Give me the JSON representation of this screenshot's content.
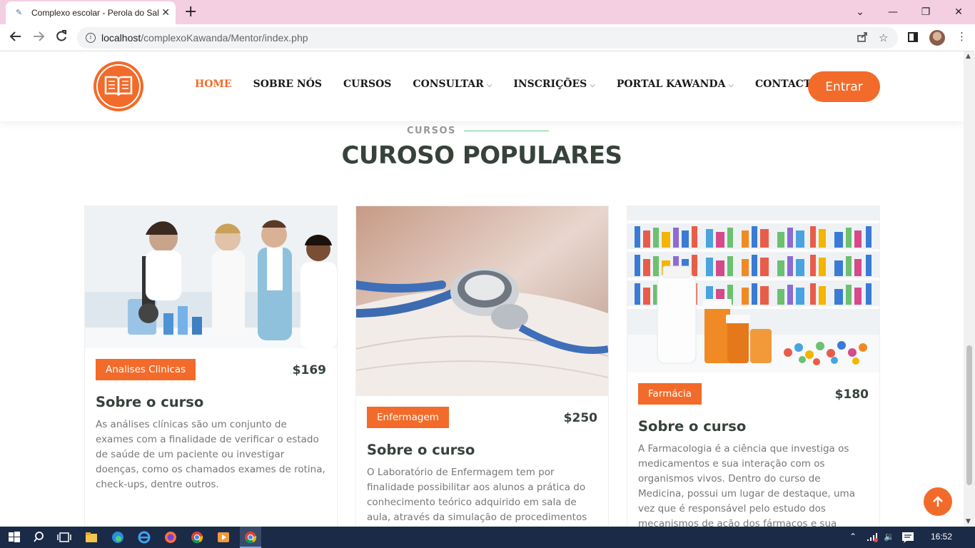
{
  "browser": {
    "tab_title": "Complexo escolar - Perola do Sal",
    "tab_close": "✕",
    "new_tab": "+",
    "url_host": "localhost",
    "url_path": "/complexoKawanda/Mentor/index.php",
    "window_controls": [
      "⌄",
      "—",
      "❐",
      "✕"
    ]
  },
  "nav": {
    "items": [
      {
        "label": "HOME",
        "active": true,
        "dropdown": false
      },
      {
        "label": "SOBRE NÓS",
        "active": false,
        "dropdown": false
      },
      {
        "label": "CURSOS",
        "active": false,
        "dropdown": false
      },
      {
        "label": "CONSULTAR",
        "active": false,
        "dropdown": true
      },
      {
        "label": "INSCRIÇÕES",
        "active": false,
        "dropdown": true
      },
      {
        "label": "PORTAL KAWANDA",
        "active": false,
        "dropdown": true
      },
      {
        "label": "CONTACTO",
        "active": false,
        "dropdown": false
      }
    ],
    "caret": "⌵",
    "cta_label": "Entrar"
  },
  "section": {
    "eyebrow": "CURSOS",
    "title": "CUROSO POPULARES"
  },
  "courses": [
    {
      "category": "Analises Clinicas",
      "price": "$169",
      "heading": "Sobre o curso",
      "description": "As análises clínicas são um conjunto de exames com a finalidade de verificar o estado de saúde de um paciente ou investigar doenças, como os chamados exames de rotina, check-ups, dentre outros."
    },
    {
      "category": "Enfermagem",
      "price": "$250",
      "heading": "Sobre o curso",
      "description": "O Laboratório de Enfermagem tem por finalidade possibilitar aos alunos a prática do conhecimento teórico adquirido em sala de aula, através da simulação de procedimentos de enfermagem."
    },
    {
      "category": "Farmácia",
      "price": "$180",
      "heading": "Sobre o curso",
      "description": "A Farmacologia é a ciência que investiga os medicamentos e sua interação com os organismos vivos. Dentro do curso de Medicina, possui um lugar de destaque, uma vez que é responsável pelo estudo dos mecanismos de ação dos fármacos e sua aplicação na prática"
    }
  ],
  "taskbar": {
    "time": "16:52"
  },
  "colors": {
    "accent": "#f26b2a",
    "heading": "#37423b",
    "eyebrow_line": "#5fcf80",
    "taskbar": "#1b2a47",
    "tabbar": "#f4cfe1"
  }
}
